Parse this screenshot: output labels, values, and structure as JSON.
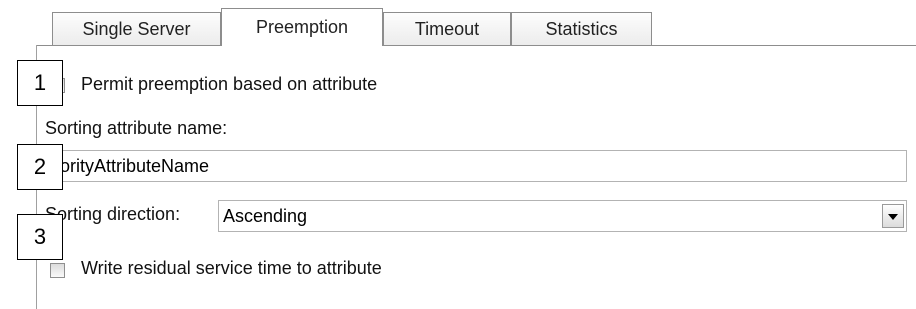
{
  "tabs": [
    {
      "label": "Single Server",
      "active": false
    },
    {
      "label": "Preemption",
      "active": true
    },
    {
      "label": "Timeout",
      "active": false
    },
    {
      "label": "Statistics",
      "active": false
    }
  ],
  "preemption": {
    "permit_checkbox_label": "Permit preemption based on attribute",
    "permit_checked": false,
    "sorting_attribute_label": "Sorting attribute name:",
    "sorting_attribute_value": "riorityAttributeName",
    "sorting_direction_label": "Sorting direction:",
    "sorting_direction_value": "Ascending",
    "residual_checkbox_label": "Write residual service time to attribute",
    "residual_checked": false
  },
  "callouts": [
    "1",
    "2",
    "3"
  ]
}
